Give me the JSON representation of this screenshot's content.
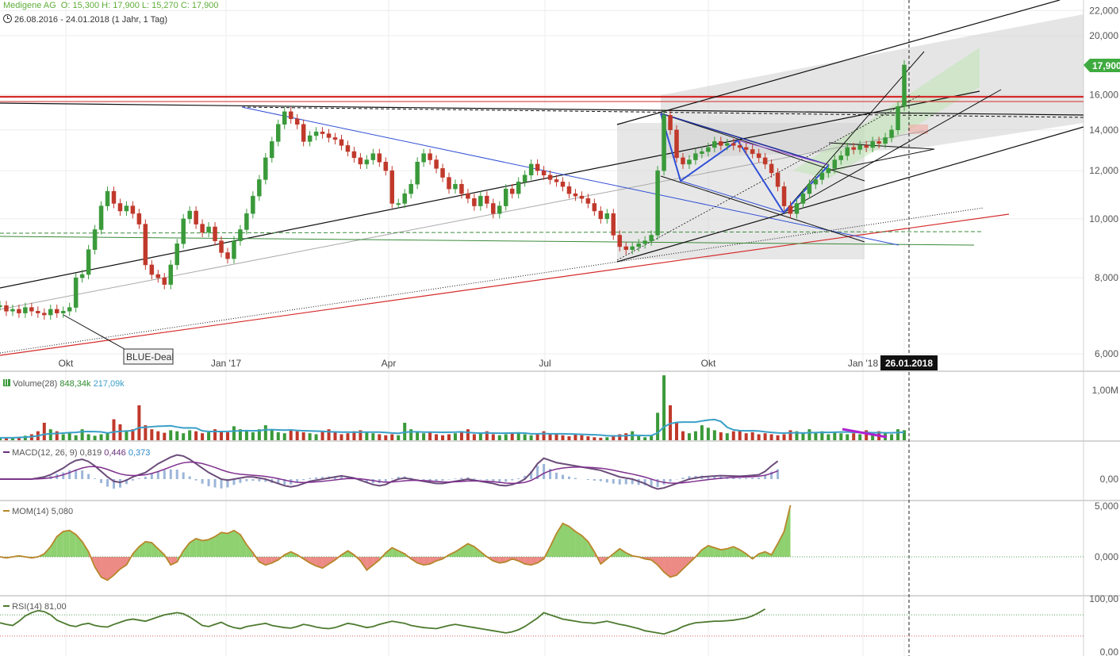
{
  "header": {
    "instrument": "Medigene AG",
    "ohlc_text": "O: 15,300  H: 17,900  L: 15,270  C: 17,900",
    "range_text": "26.08.2016 - 24.01.2018  (1 Jahr, 1 Tag)",
    "clock_icon": "clock-icon"
  },
  "colors": {
    "up": "#3a9a3a",
    "down": "#c0392b",
    "resistance": "#d62a2a",
    "volume_ma": "#3aa0c8",
    "macd": "#6b4c7a",
    "signal": "#7e2f8e",
    "histogram": "#9cb6d9",
    "mom_line": "#b8862b",
    "mom_pos": "#8fd170",
    "mom_neg": "#ec8a86",
    "rsi_line": "#4d7a2f",
    "price_tag": "#3fab3f"
  },
  "annotations": {
    "blue_deal_label": "BLUE-Deal",
    "crosshair_date": "26.01.2018"
  },
  "price_tag": "17,900",
  "indicators": {
    "volume": {
      "label": "Volume(28)",
      "v1": "848,34k",
      "v2": "217,09k",
      "axis": [
        "1,00M"
      ]
    },
    "macd": {
      "label": "MACD(12, 26, 9)",
      "v1": "0,819",
      "v2": "0,446",
      "v3": "0,373",
      "axis": [
        "0,00"
      ]
    },
    "mom": {
      "label": "MOM(14)",
      "v1": "5,080",
      "axis": [
        "5,000",
        "0,000"
      ]
    },
    "rsi": {
      "label": "RSI(14)",
      "v1": "81,00",
      "axis": [
        "100,00",
        "0,00"
      ]
    }
  },
  "chart_data": [
    {
      "type": "candlestick",
      "title": "Medigene AG",
      "scale": "log",
      "ylim": [
        5.6,
        22.5
      ],
      "ytick_labels": [
        "22,000",
        "20,000",
        "16,000",
        "14,000",
        "12,000",
        "10,000",
        "8,000",
        "6,000"
      ],
      "yticks": [
        22,
        20,
        16,
        14,
        12,
        10,
        8,
        6
      ],
      "xtick_labels": [
        "Okt",
        "Jan '17",
        "Apr",
        "Jul",
        "Okt",
        "Jan '18"
      ],
      "x_range": [
        "2016-08-26",
        "2018-01-24"
      ],
      "last": {
        "open": 15.3,
        "high": 17.9,
        "low": 15.27,
        "close": 17.9
      },
      "series": [
        {
          "values": [
            7.2,
            7.05,
            7.1,
            7.0,
            7.15,
            7.05,
            7.0,
            6.95,
            7.1,
            7.0,
            7.05,
            7.15,
            8.0,
            8.1,
            8.9,
            9.6,
            10.5,
            11.1,
            10.6,
            10.3,
            10.5,
            10.2,
            9.8,
            8.4,
            8.1,
            8.0,
            7.8,
            8.4,
            9.1,
            10.0,
            10.3,
            9.8,
            9.5,
            9.7,
            9.2,
            8.8,
            8.6,
            9.2,
            9.6,
            10.2,
            10.9,
            11.6,
            12.6,
            13.4,
            14.3,
            15.0,
            14.6,
            14.3,
            13.4,
            13.7,
            13.9,
            13.8,
            13.6,
            13.5,
            13.2,
            12.9,
            12.6,
            12.3,
            12.5,
            12.8,
            12.4,
            12.0,
            10.6,
            10.6,
            11.0,
            11.4,
            12.4,
            12.8,
            12.5,
            12.1,
            11.7,
            11.2,
            11.4,
            11.0,
            10.8,
            10.5,
            10.9,
            10.6,
            10.2,
            10.5,
            11.2,
            11.0,
            11.5,
            11.8,
            12.3,
            12.0,
            11.8,
            11.6,
            11.5,
            11.3,
            11.0,
            10.9,
            10.8,
            10.6,
            10.3,
            10.0,
            10.2,
            9.4,
            9.0,
            8.9,
            9.0,
            9.1,
            9.2,
            9.4,
            12.0,
            14.8,
            14.0,
            12.6,
            12.3,
            12.5,
            12.8,
            12.9,
            13.1,
            13.4,
            13.2,
            13.3,
            13.2,
            13.1,
            13.0,
            12.8,
            12.6,
            12.3,
            11.9,
            11.3,
            10.5,
            10.2,
            10.6,
            11.0,
            11.4,
            11.6,
            11.9,
            12.1,
            12.5,
            12.7,
            13.1,
            13.0,
            13.2,
            13.1,
            13.4,
            13.3,
            13.6,
            14.0,
            15.3,
            17.9
          ]
        },
        {
          "name": "Volume(28)",
          "values": [
            0.05,
            0.05,
            0.05,
            0.07,
            0.09,
            0.12,
            0.18,
            0.35,
            0.22,
            0.18,
            0.12,
            0.14,
            0.1,
            0.22,
            0.12,
            0.09,
            0.12,
            0.14,
            0.42,
            0.32,
            0.18,
            0.22,
            0.7,
            0.3,
            0.22,
            0.18,
            0.15,
            0.2,
            0.18,
            0.14,
            0.2,
            0.18,
            0.14,
            0.16,
            0.22,
            0.18,
            0.16,
            0.28,
            0.22,
            0.18,
            0.16,
            0.22,
            0.3,
            0.2,
            0.16,
            0.14,
            0.2,
            0.18,
            0.16,
            0.14,
            0.12,
            0.18,
            0.22,
            0.16,
            0.12,
            0.14,
            0.18,
            0.2,
            0.16,
            0.14,
            0.12,
            0.1,
            0.12,
            0.1,
            0.35,
            0.22,
            0.18,
            0.14,
            0.16,
            0.12,
            0.1,
            0.12,
            0.14,
            0.16,
            0.22,
            0.12,
            0.14,
            0.18,
            0.12,
            0.1,
            0.12,
            0.14,
            0.16,
            0.12,
            0.1,
            0.12,
            0.18,
            0.14,
            0.12,
            0.1,
            0.08,
            0.12,
            0.1,
            0.08,
            0.06,
            0.05,
            0.06,
            0.1,
            0.12,
            0.14,
            0.18,
            0.08,
            0.06,
            0.1,
            0.55,
            1.3,
            0.7,
            0.35,
            0.18,
            0.14,
            0.18,
            0.3,
            0.25,
            0.2,
            0.16,
            0.14,
            0.18,
            0.2,
            0.14,
            0.16,
            0.12,
            0.14,
            0.12,
            0.1,
            0.12,
            0.2,
            0.18,
            0.16,
            0.22,
            0.16,
            0.18,
            0.12,
            0.16,
            0.14,
            0.12,
            0.14,
            0.12,
            0.2,
            0.16,
            0.18,
            0.14,
            0.12,
            0.22,
            0.2,
            0.28,
            0.75
          ]
        },
        {
          "name": "MACD(12, 26, 9)",
          "values": [
            0.0,
            0.0,
            0.0,
            0.0,
            0.0,
            0.0,
            0.05,
            0.1,
            0.2,
            0.35,
            0.5,
            0.7,
            0.85,
            0.9,
            0.8,
            0.6,
            0.35,
            0.1,
            -0.1,
            -0.15,
            -0.05,
            0.1,
            0.2,
            0.3,
            0.5,
            0.7,
            0.85,
            1.0,
            1.1,
            1.05,
            0.9,
            0.7,
            0.5,
            0.3,
            0.15,
            0.0,
            -0.05,
            0.0,
            0.05,
            0.1,
            0.1,
            0.05,
            0.0,
            -0.1,
            -0.2,
            -0.3,
            -0.35,
            -0.3,
            -0.2,
            -0.1,
            -0.05,
            0.0,
            0.05,
            0.1,
            0.15,
            0.1,
            0.05,
            -0.05,
            -0.15,
            -0.25,
            -0.3,
            -0.25,
            -0.1,
            0.0,
            0.05,
            0.0,
            -0.05,
            -0.1,
            -0.15,
            -0.2,
            -0.2,
            -0.15,
            -0.1,
            -0.05,
            0.0,
            -0.05,
            -0.1,
            -0.15,
            -0.2,
            -0.28,
            -0.3,
            -0.25,
            -0.15,
            0.0,
            0.3,
            0.7,
            0.95,
            0.85,
            0.75,
            0.7,
            0.65,
            0.6,
            0.55,
            0.5,
            0.45,
            0.4,
            0.3,
            0.2,
            0.1,
            0.05,
            0.0,
            -0.1,
            -0.2,
            -0.35,
            -0.45,
            -0.4,
            -0.3,
            -0.2,
            -0.1,
            0.0,
            0.05,
            0.1,
            0.12,
            0.14,
            0.16,
            0.15,
            0.14,
            0.13,
            0.15,
            0.17,
            0.2,
            0.35,
            0.6,
            0.82
          ]
        },
        {
          "name": "MOM(14)",
          "values": [
            0.0,
            -0.1,
            0.0,
            0.1,
            0.0,
            -0.1,
            0.0,
            0.3,
            1.0,
            2.0,
            2.5,
            2.6,
            2.2,
            1.5,
            0.5,
            -1.0,
            -2.0,
            -2.3,
            -1.8,
            -1.2,
            -0.8,
            0.3,
            1.0,
            1.5,
            1.4,
            0.8,
            0.2,
            -0.8,
            -0.5,
            0.6,
            1.4,
            1.8,
            1.6,
            1.7,
            2.0,
            2.4,
            2.3,
            2.6,
            2.2,
            1.2,
            0.4,
            -0.5,
            -0.8,
            -0.6,
            -0.3,
            0.2,
            0.5,
            0.2,
            -0.2,
            -0.6,
            -0.9,
            -1.1,
            -0.7,
            -0.3,
            0.2,
            0.6,
            0.2,
            -0.4,
            -1.3,
            -0.8,
            -0.3,
            0.4,
            0.9,
            0.6,
            0.3,
            -0.2,
            -0.6,
            -0.8,
            -0.7,
            -0.4,
            -0.2,
            0.2,
            0.5,
            0.9,
            1.3,
            1.0,
            0.5,
            0.0,
            -0.4,
            -0.6,
            -0.5,
            -0.2,
            -0.4,
            -0.7,
            -0.8,
            -0.6,
            -0.2,
            1.0,
            2.3,
            3.3,
            3.0,
            2.5,
            2.1,
            1.5,
            0.5,
            -0.7,
            -0.2,
            0.3,
            0.8,
            0.4,
            0.1,
            0.0,
            -0.2,
            -0.3,
            -0.8,
            -1.5,
            -2.0,
            -1.8,
            -1.2,
            -0.6,
            0.0,
            0.7,
            1.1,
            0.9,
            0.7,
            0.8,
            1.0,
            0.7,
            0.3,
            -0.2,
            0.3,
            0.5,
            0.2,
            1.3,
            2.5,
            5.08
          ]
        },
        {
          "name": "RSI(14)",
          "values": [
            55,
            52,
            50,
            58,
            68,
            74,
            78,
            76,
            70,
            60,
            55,
            50,
            48,
            52,
            54,
            50,
            48,
            47,
            52,
            56,
            60,
            62,
            60,
            58,
            62,
            66,
            70,
            72,
            74,
            72,
            66,
            58,
            50,
            48,
            52,
            56,
            50,
            46,
            44,
            48,
            50,
            52,
            54,
            50,
            48,
            46,
            45,
            48,
            52,
            50,
            47,
            45,
            44,
            46,
            50,
            54,
            52,
            49,
            46,
            48,
            52,
            55,
            58,
            56,
            54,
            50,
            48,
            46,
            45,
            44,
            47,
            50,
            52,
            50,
            48,
            46,
            44,
            42,
            40,
            38,
            36,
            38,
            42,
            48,
            56,
            64,
            74,
            70,
            66,
            62,
            60,
            58,
            56,
            55,
            54,
            56,
            58,
            55,
            52,
            50,
            47,
            44,
            40,
            38,
            36,
            34,
            38,
            42,
            48,
            52,
            55,
            56,
            57,
            58,
            58,
            59,
            60,
            62,
            64,
            68,
            74,
            81
          ]
        }
      ]
    }
  ]
}
